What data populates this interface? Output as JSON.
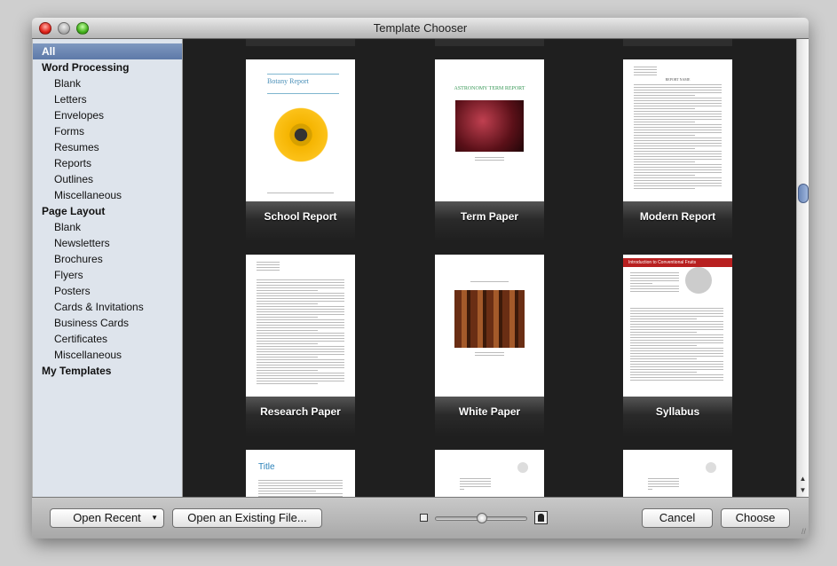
{
  "window": {
    "title": "Template Chooser"
  },
  "sidebar": {
    "items": [
      {
        "label": "All",
        "type": "sel"
      },
      {
        "label": "Word Processing",
        "type": "head"
      },
      {
        "label": "Blank",
        "type": "sub"
      },
      {
        "label": "Letters",
        "type": "sub"
      },
      {
        "label": "Envelopes",
        "type": "sub"
      },
      {
        "label": "Forms",
        "type": "sub"
      },
      {
        "label": "Resumes",
        "type": "sub"
      },
      {
        "label": "Reports",
        "type": "sub"
      },
      {
        "label": "Outlines",
        "type": "sub"
      },
      {
        "label": "Miscellaneous",
        "type": "sub"
      },
      {
        "label": "Page Layout",
        "type": "head"
      },
      {
        "label": "Blank",
        "type": "sub"
      },
      {
        "label": "Newsletters",
        "type": "sub"
      },
      {
        "label": "Brochures",
        "type": "sub"
      },
      {
        "label": "Flyers",
        "type": "sub"
      },
      {
        "label": "Posters",
        "type": "sub"
      },
      {
        "label": "Cards & Invitations",
        "type": "sub"
      },
      {
        "label": "Business Cards",
        "type": "sub"
      },
      {
        "label": "Certificates",
        "type": "sub"
      },
      {
        "label": "Miscellaneous",
        "type": "sub"
      },
      {
        "label": "My Templates",
        "type": "head"
      }
    ]
  },
  "templates": [
    {
      "label": "School Report",
      "heading": "Botany Report",
      "kind": "flower"
    },
    {
      "label": "Term Paper",
      "heading": "ASTRONOMY TERM REPORT",
      "kind": "space"
    },
    {
      "label": "Modern Report",
      "heading": "REPORT NAME",
      "kind": "text"
    },
    {
      "label": "Research Paper",
      "heading": "",
      "kind": "text"
    },
    {
      "label": "White Paper",
      "heading": "",
      "kind": "forest"
    },
    {
      "label": "Syllabus",
      "heading": "Introduction to Conventional Fruits",
      "kind": "syllabus"
    },
    {
      "label": "",
      "heading": "Title",
      "kind": "title"
    },
    {
      "label": "",
      "heading": "",
      "kind": "letter"
    },
    {
      "label": "",
      "heading": "",
      "kind": "letter"
    }
  ],
  "bottom": {
    "open_recent": "Open Recent",
    "open_existing": "Open an Existing File...",
    "cancel": "Cancel",
    "choose": "Choose",
    "zoom_level": 0.5
  },
  "colors": {
    "selection": "#6a84b2",
    "background": "#1f1f1f"
  }
}
